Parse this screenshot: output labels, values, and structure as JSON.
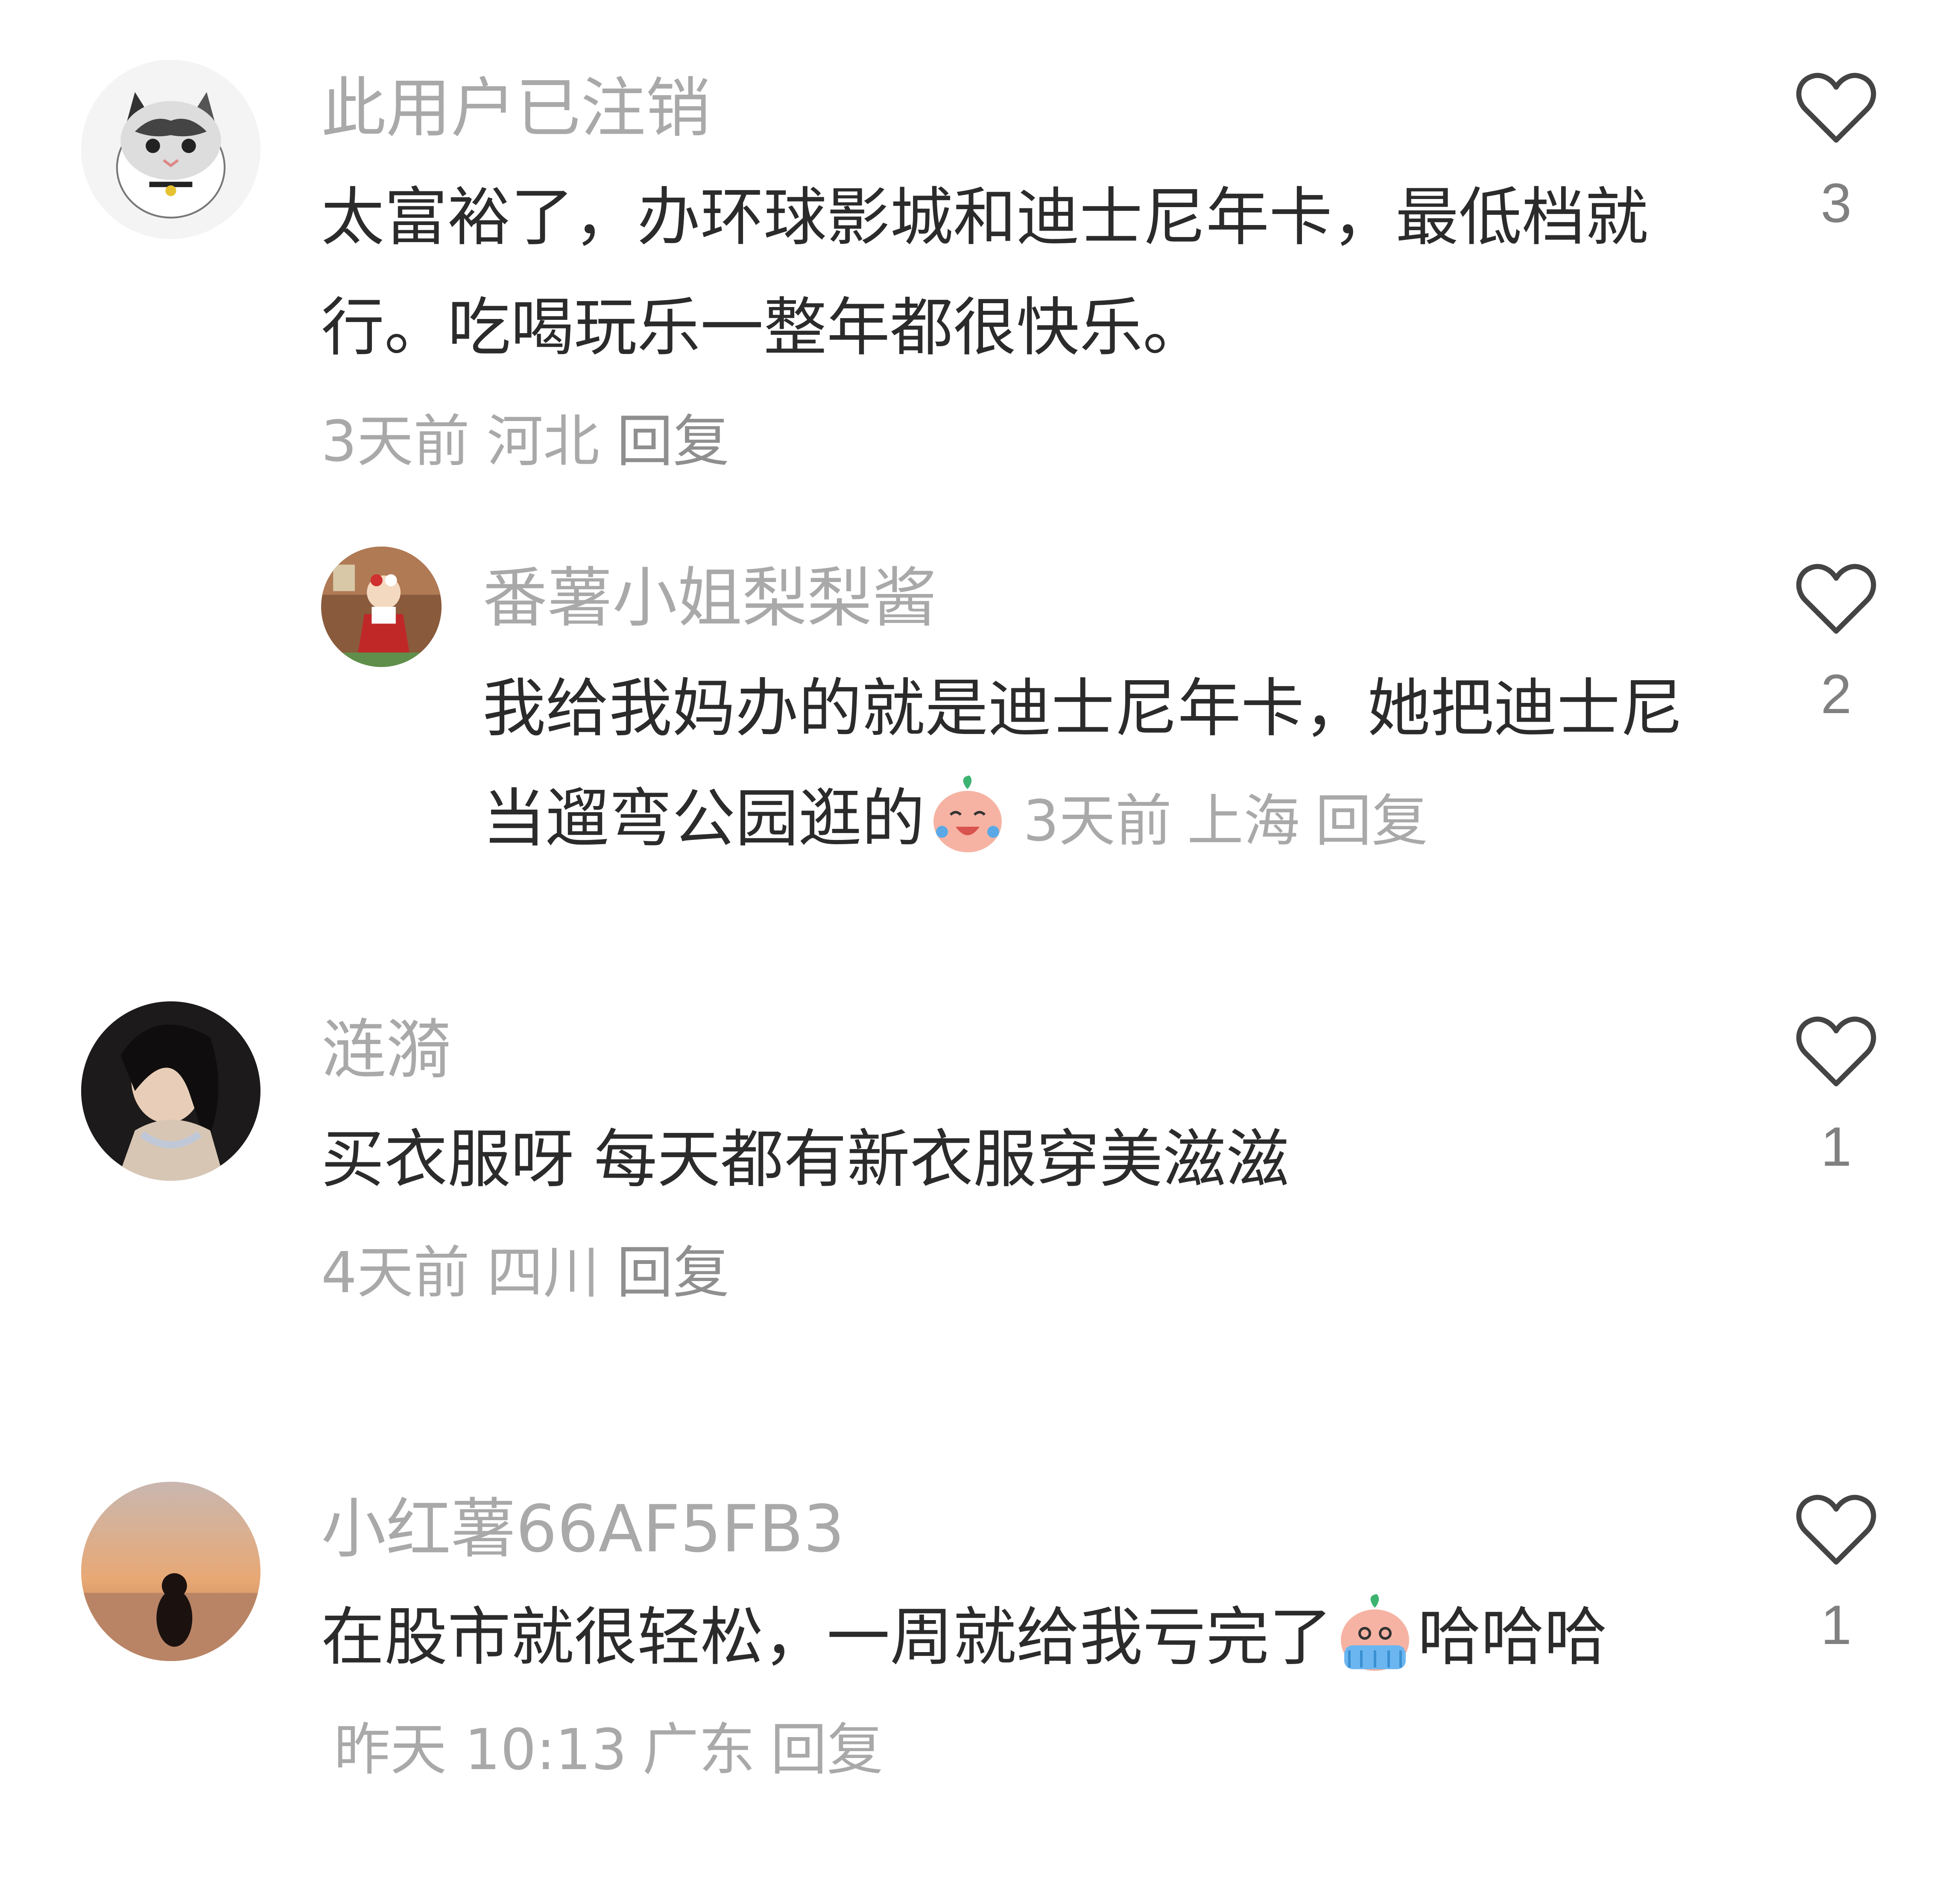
{
  "comments": [
    {
      "author": "此用户已注销",
      "text": "太富裕了，办环球影城和迪士尼年卡，最低档就行。吃喝玩乐一整年都很快乐。",
      "time": "3天前",
      "location": "河北",
      "reply_label": "回复",
      "likes": "3",
      "avatar": "cat-avatar"
    },
    {
      "author": "番薯小姐梨梨酱",
      "text": "我给我妈办的就是迪士尼年卡，她把迪士尼当遛弯公园逛的",
      "emoji": "laughing-crying-emoji",
      "time": "3天前",
      "location": "上海",
      "reply_label": "回复",
      "likes": "2",
      "avatar": "game-character-avatar"
    },
    {
      "author": "涟漪",
      "text": "买衣服呀 每天都有新衣服穿美滋滋",
      "time": "4天前",
      "location": "四川",
      "reply_label": "回复",
      "likes": "1",
      "avatar": "woman-portrait-avatar"
    },
    {
      "author": "小红薯66AF5FB3",
      "text_before": "在股市就很轻松，一周就给我亏完了",
      "emoji": "crying-emoji",
      "text_after": "哈哈哈",
      "time": "昨天 10:13",
      "location": "广东",
      "reply_label": "回复",
      "likes": "1",
      "avatar": "sunset-avatar"
    }
  ],
  "colors": {
    "author": "#a9a9a9",
    "text": "#2b2b2b",
    "meta": "#a9a9a9",
    "like_icon": "#444444"
  }
}
